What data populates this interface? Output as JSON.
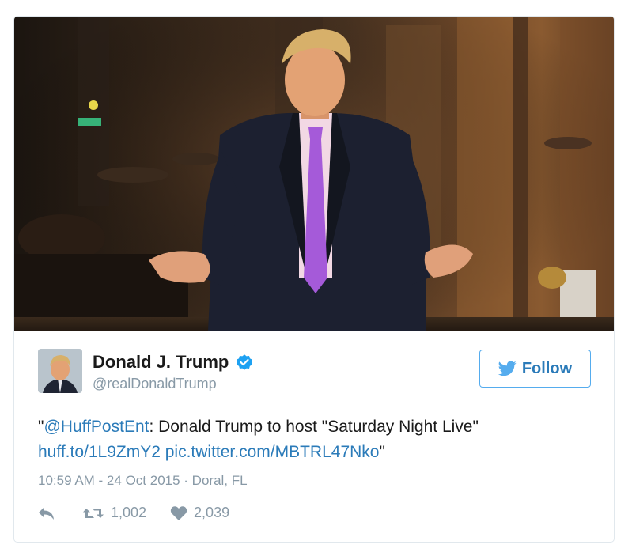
{
  "colors": {
    "link": "#2b7bb9",
    "follow_border": "#55acee",
    "muted": "#8899a6",
    "verified": "#1da1f2",
    "tie": "#a55ad9"
  },
  "media": {
    "description_icon": "photo"
  },
  "author": {
    "display_name": "Donald J. Trump",
    "handle": "@realDonaldTrump",
    "verified_icon": "verified-badge-icon",
    "avatar_icon": "avatar"
  },
  "follow": {
    "label": "Follow",
    "icon": "twitter-bird-icon"
  },
  "tweet": {
    "quote_open": "\"",
    "mention": "@HuffPostEnt",
    "body": ": Donald Trump to host \"Saturday Night Live\"",
    "link1": "huff.to/1L9ZmY2",
    "space": " ",
    "link2": "pic.twitter.com/MBTRL47Nko",
    "quote_close": "\""
  },
  "meta": {
    "time": "10:59 AM - 24 Oct 2015",
    "separator": " · ",
    "location": "Doral, FL"
  },
  "actions": {
    "reply_icon": "reply-icon",
    "retweet_icon": "retweet-icon",
    "retweet_count": "1,002",
    "like_icon": "heart-icon",
    "like_count": "2,039"
  }
}
